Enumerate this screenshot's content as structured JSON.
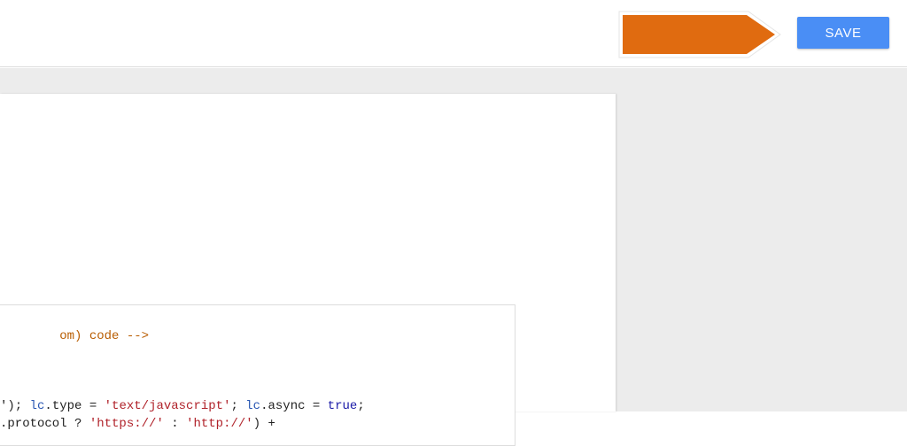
{
  "toolbar": {
    "save_label": "SAVE",
    "accent_color": "#4a8ef5",
    "callout_color": "#e06b10"
  },
  "code": {
    "line1": {
      "comment": "om) code -->"
    },
    "line2": {
      "p1": "'); ",
      "v1": "lc",
      "p2": ".type = ",
      "s1": "'text/javascript'",
      "p3": "; ",
      "v2": "lc",
      "p4": ".async = ",
      "k1": "true",
      "p5": ";"
    },
    "line3": {
      "p1": ".protocol ? ",
      "s1": "'https://'",
      "p2": " : ",
      "s2": "'http://'",
      "p3": ") +"
    }
  }
}
